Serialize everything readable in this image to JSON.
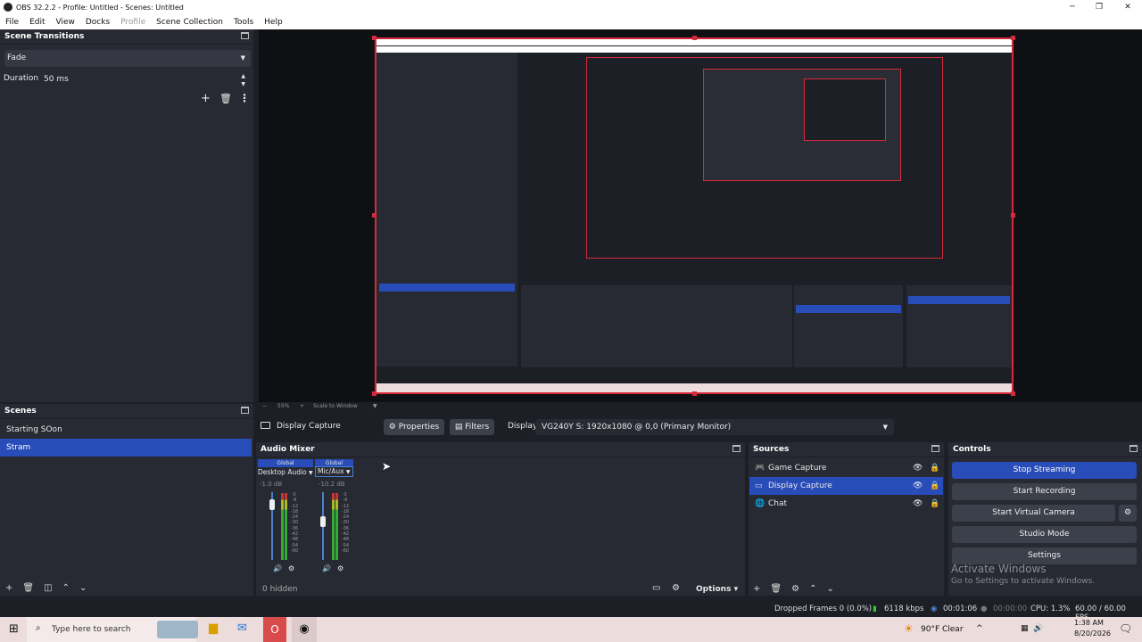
{
  "window": {
    "title": "OBS 32.2.2 - Profile: Untitled - Scenes: Untitled",
    "minimize": "─",
    "maximize": "❐",
    "close": "✕"
  },
  "menu": [
    "File",
    "Edit",
    "View",
    "Docks",
    "Profile",
    "Scene Collection",
    "Tools",
    "Help"
  ],
  "transitions": {
    "title": "Scene Transitions",
    "selected": "Fade",
    "duration_label": "Duration",
    "duration_value": "50 ms"
  },
  "scenes": {
    "title": "Scenes",
    "items": [
      "Starting SOon",
      "Stram"
    ],
    "selected": "Stram"
  },
  "preview_toolbar": {
    "zoom": "55%",
    "scale": "Scale to Window"
  },
  "source_toolbar": {
    "source": "Display Capture",
    "properties": "Properties",
    "filters": "Filters",
    "display_label": "Display",
    "display_value": "VG240Y S: 1920x1080 @ 0,0 (Primary Monitor)"
  },
  "audio_mixer": {
    "title": "Audio Mixer",
    "channels": [
      {
        "tag": "Global",
        "name": "Desktop Audio",
        "db": "-1.0 dB",
        "level": 0.88
      },
      {
        "tag": "Global",
        "name": "Mic/Aux",
        "db": "-10.2 dB",
        "level": 0.62
      }
    ],
    "ticks": [
      "0",
      "-6",
      "-12",
      "-18",
      "-24",
      "-30",
      "-36",
      "-42",
      "-48",
      "-54",
      "-60"
    ],
    "hidden": "0 hidden",
    "options": "Options"
  },
  "sources": {
    "title": "Sources",
    "items": [
      {
        "name": "Game Capture",
        "icon": "gamepad-icon"
      },
      {
        "name": "Display Capture",
        "icon": "monitor-icon"
      },
      {
        "name": "Chat",
        "icon": "globe-icon"
      }
    ],
    "selected": "Display Capture"
  },
  "controls": {
    "title": "Controls",
    "stop_streaming": "Stop Streaming",
    "start_recording": "Start Recording",
    "start_virtual_camera": "Start Virtual Camera",
    "studio_mode": "Studio Mode",
    "settings": "Settings"
  },
  "activate": {
    "line1": "Activate Windows",
    "line2": "Go to Settings to activate Windows."
  },
  "status": {
    "dropped": "Dropped Frames 0 (0.0%)",
    "kbps": "6118 kbps",
    "stream_time": "00:01:06",
    "rec_time": "00:00:00",
    "cpu": "CPU: 1.3%",
    "fps": "60.00 / 60.00 FPS"
  },
  "taskbar": {
    "search": "Type here to search",
    "weather": "90°F  Clear",
    "time": "1:38 AM",
    "date": "8/20/2026"
  },
  "colors": {
    "accent": "#284cb8",
    "stream_red": "#d42a3b",
    "panel": "#272a33",
    "background": "#1d1f26"
  }
}
